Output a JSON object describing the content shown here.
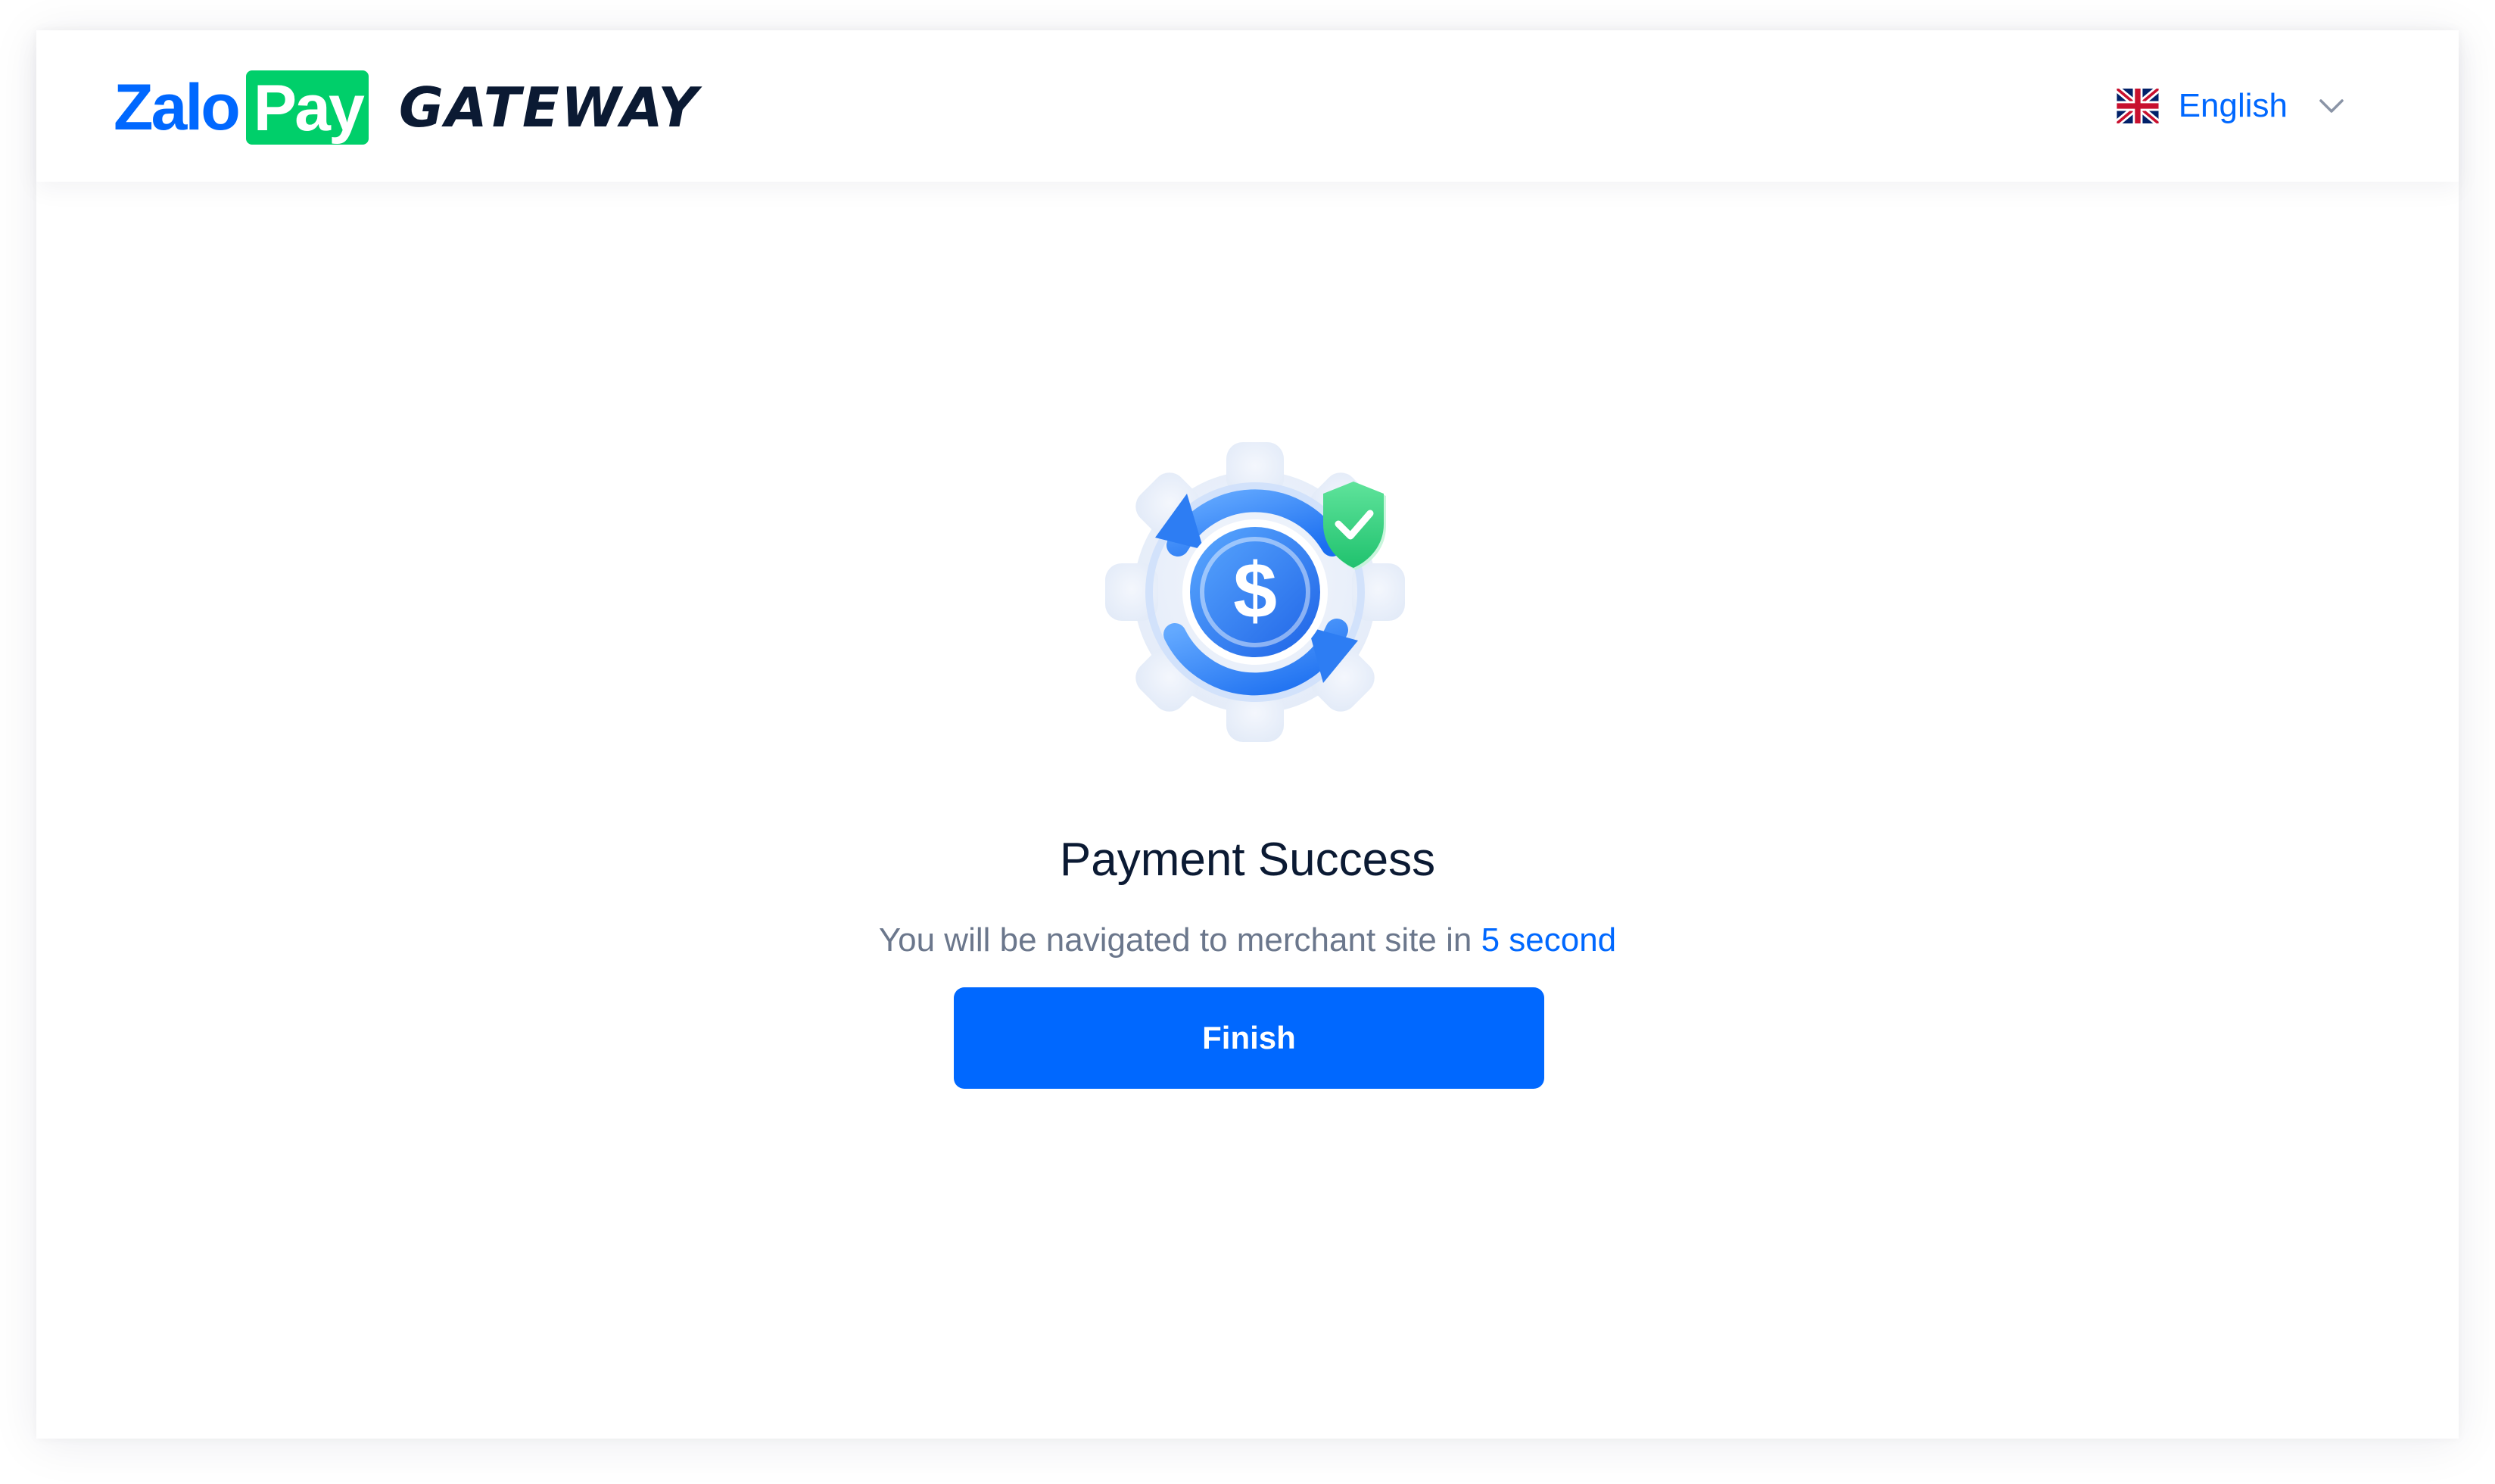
{
  "header": {
    "brand": {
      "zalo": "Zalo",
      "pay": "Pay",
      "gateway": "GATEWAY"
    },
    "language": {
      "flag_icon": "uk-flag-icon",
      "label": "English",
      "dropdown_icon": "chevron-down-icon"
    }
  },
  "status": {
    "icon": "payment-success-gear-dollar-shield-icon",
    "title": "Payment Success",
    "message_prefix": "You will be navigated to merchant site in",
    "countdown": "5 second"
  },
  "actions": {
    "finish_label": "Finish"
  },
  "colors": {
    "brand_blue": "#0068ff",
    "brand_green": "#00cf6a",
    "text_dark": "#0b1a33",
    "text_muted": "#6b778c",
    "shield_green": "#2ed47a"
  }
}
